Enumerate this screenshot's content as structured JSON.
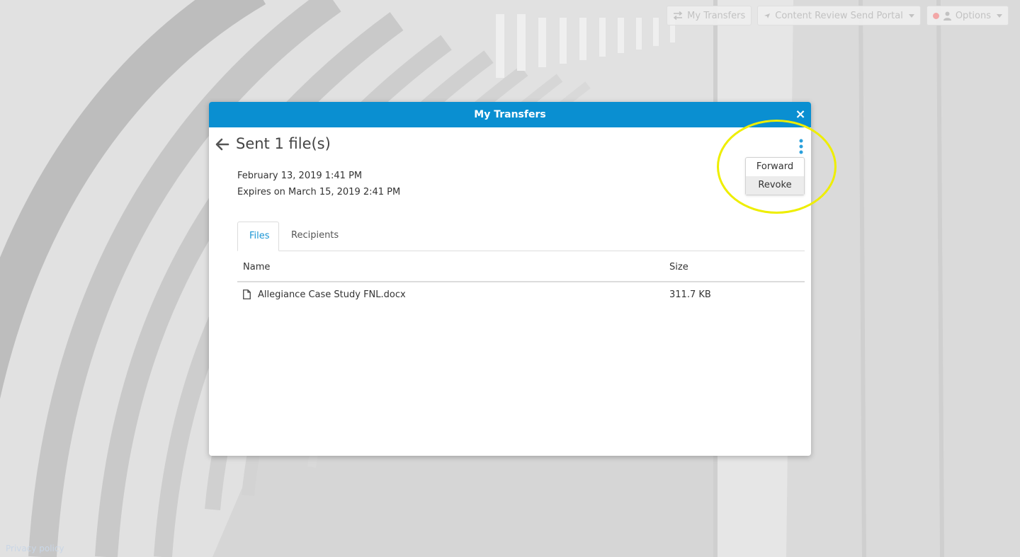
{
  "toolbar": {
    "my_transfers": "My Transfers",
    "portal": "Content Review Send Portal",
    "options": "Options"
  },
  "modal": {
    "title": "My Transfers",
    "close_glyph": "×",
    "heading": "Sent 1 file(s)",
    "sent_date": "February 13, 2019 1:41 PM",
    "expires": "Expires on March 15, 2019 2:41 PM",
    "menu": [
      {
        "label": "Forward"
      },
      {
        "label": "Revoke"
      }
    ],
    "tabs": [
      {
        "label": "Files",
        "active": true
      },
      {
        "label": "Recipients",
        "active": false
      }
    ],
    "table": {
      "headers": {
        "name": "Name",
        "size": "Size"
      },
      "rows": [
        {
          "name": "Allegiance Case Study FNL.docx",
          "size": "311.7 KB"
        }
      ]
    }
  },
  "footer": {
    "privacy": "Privacy policy"
  },
  "colors": {
    "accent": "#0a8fd1",
    "tab_active": "#1a95d4",
    "highlight": "#eeee00"
  },
  "icons": [
    "transfer-icon",
    "send-icon",
    "status-dot-icon",
    "user-icon",
    "close-icon",
    "back-arrow-icon",
    "kebab-menu-icon",
    "file-icon"
  ]
}
